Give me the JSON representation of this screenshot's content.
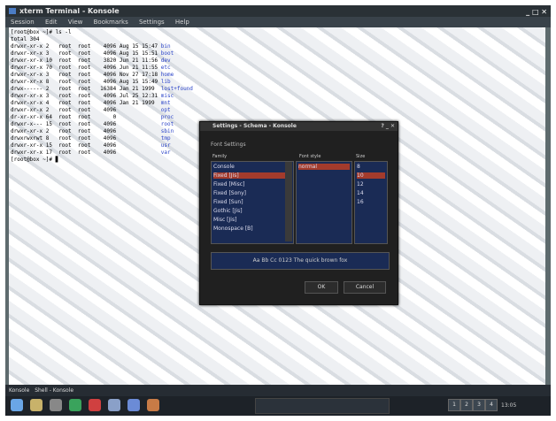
{
  "window": {
    "title": "xterm Terminal - Konsole",
    "menu": [
      "Session",
      "Edit",
      "View",
      "Bookmarks",
      "Settings",
      "Help"
    ]
  },
  "terminal": {
    "header": [
      "[root@box ~]# ls -l",
      "total 304"
    ],
    "rows": [
      {
        "perm": "drwxr-xr-x",
        "n": "2",
        "owner": "root",
        "group": "root",
        "size": "4096",
        "date": "Aug 15 15:47",
        "name": "bin"
      },
      {
        "perm": "drwxr-xr-x",
        "n": "3",
        "owner": "root",
        "group": "root",
        "size": "4096",
        "date": "Aug 15 15:51",
        "name": "boot"
      },
      {
        "perm": "drwxr-xr-x",
        "n": "10",
        "owner": "root",
        "group": "root",
        "size": "3820",
        "date": "Jun 21 11:56",
        "name": "dev"
      },
      {
        "perm": "drwxr-xr-x",
        "n": "70",
        "owner": "root",
        "group": "root",
        "size": "4096",
        "date": "Jun 21 11:55",
        "name": "etc"
      },
      {
        "perm": "drwxr-xr-x",
        "n": "3",
        "owner": "root",
        "group": "root",
        "size": "4096",
        "date": "Nov 27 17:18",
        "name": "home"
      },
      {
        "perm": "drwxr-xr-x",
        "n": "8",
        "owner": "root",
        "group": "root",
        "size": "4096",
        "date": "Aug 15 15:49",
        "name": "lib"
      },
      {
        "perm": "drwx------",
        "n": "2",
        "owner": "root",
        "group": "root",
        "size": "16384",
        "date": "Jan 21 1999",
        "name": "lost+found"
      },
      {
        "perm": "drwxr-xr-x",
        "n": "3",
        "owner": "root",
        "group": "root",
        "size": "4096",
        "date": "Jul 25 12:31",
        "name": "misc"
      },
      {
        "perm": "drwxr-xr-x",
        "n": "4",
        "owner": "root",
        "group": "root",
        "size": "4096",
        "date": "Jan 21 1999",
        "name": "mnt"
      },
      {
        "perm": "drwxr-xr-x",
        "n": "2",
        "owner": "root",
        "group": "root",
        "size": "4096",
        "date": "",
        "name": "opt"
      },
      {
        "perm": "dr-xr-xr-x",
        "n": "64",
        "owner": "root",
        "group": "root",
        "size": "0",
        "date": "",
        "name": "proc"
      },
      {
        "perm": "drwxr-x---",
        "n": "15",
        "owner": "root",
        "group": "root",
        "size": "4096",
        "date": "",
        "name": "root"
      },
      {
        "perm": "drwxr-xr-x",
        "n": "2",
        "owner": "root",
        "group": "root",
        "size": "4096",
        "date": "",
        "name": "sbin"
      },
      {
        "perm": "drwxrwxrwt",
        "n": "8",
        "owner": "root",
        "group": "root",
        "size": "4096",
        "date": "",
        "name": "tmp"
      },
      {
        "perm": "drwxr-xr-x",
        "n": "15",
        "owner": "root",
        "group": "root",
        "size": "4096",
        "date": "",
        "name": "usr"
      },
      {
        "perm": "drwxr-xr-x",
        "n": "17",
        "owner": "root",
        "group": "root",
        "size": "4096",
        "date": "",
        "name": "var"
      }
    ],
    "prompt": "[root@box ~]# ▊"
  },
  "dialog": {
    "title": "Settings - Schema - Konsole",
    "subtitle": "Font Settings",
    "family_header": "Family",
    "style_header": "Font style",
    "size_header": "Size",
    "families": [
      "Console",
      "Fixed [Jis]",
      "Fixed [Misc]",
      "Fixed [Sony]",
      "Fixed [Sun]",
      "Gothic [Jis]",
      "Misc [Jis]",
      "Monospace [B]"
    ],
    "selected_family_index": 1,
    "styles": [
      "normal"
    ],
    "sizes": [
      "8",
      "10",
      "12",
      "14",
      "16"
    ],
    "selected_size_index": 1,
    "sample": "Aa Bb Cc 0123 The quick brown fox",
    "ok_label": "OK",
    "cancel_label": "Cancel"
  },
  "taskbar": {
    "tasks": [
      "Konsole",
      "Shell - Konsole"
    ],
    "quick_icons": [
      {
        "name": "kde-menu-icon",
        "color": "#6aa6e6"
      },
      {
        "name": "home-icon",
        "color": "#c8b26a"
      },
      {
        "name": "terminal-icon",
        "color": "#888888"
      },
      {
        "name": "help-icon",
        "color": "#3aa35c"
      },
      {
        "name": "browser-icon",
        "color": "#d04040"
      },
      {
        "name": "mail-icon",
        "color": "#8aa0c8"
      },
      {
        "name": "editor-icon",
        "color": "#6b8bd6"
      },
      {
        "name": "network-icon",
        "color": "#c87b46"
      }
    ],
    "clock": "13:05",
    "pager": [
      "1",
      "2",
      "3",
      "4"
    ]
  }
}
